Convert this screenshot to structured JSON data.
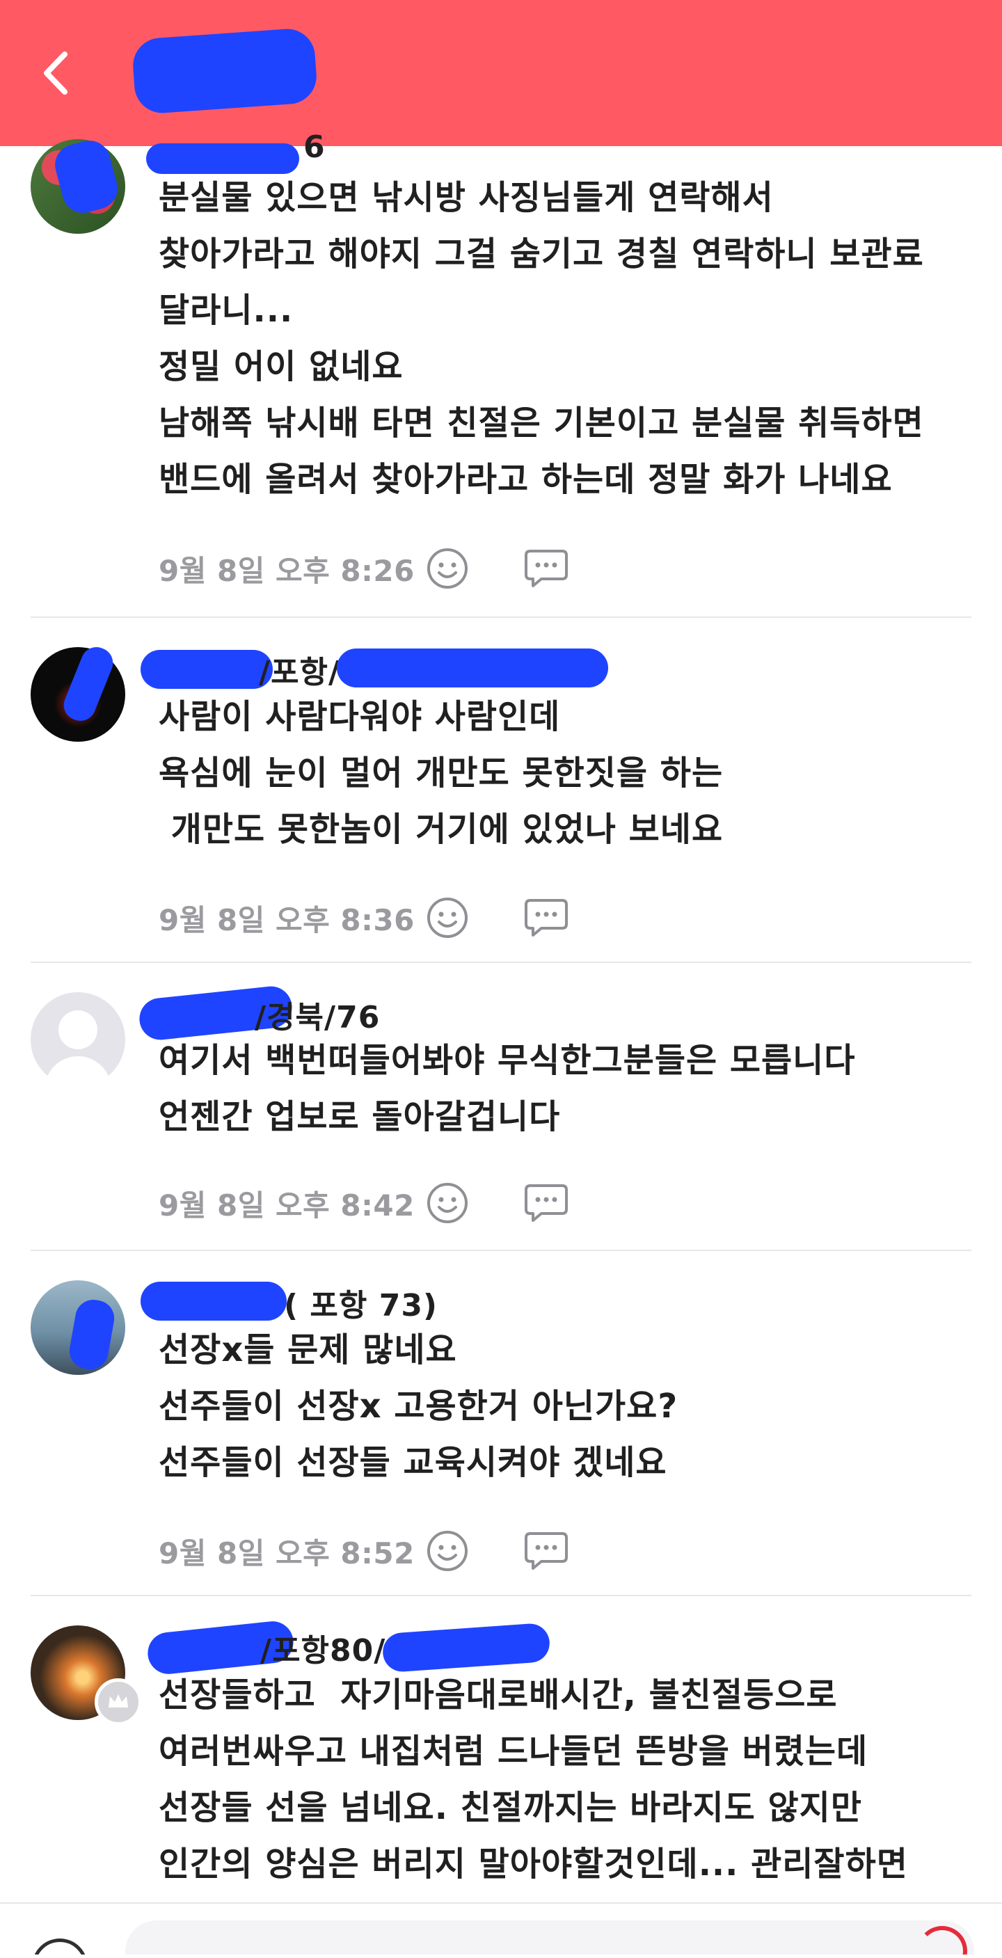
{
  "theme": {
    "accent": "#ff5a64",
    "redaction": "#1f44ff"
  },
  "header": {
    "back_icon": "chevron-left-icon",
    "title": ""
  },
  "comments": [
    {
      "author": "6",
      "avatar": "photo",
      "lines": [
        "분실물 있으면 낚시방 사징님들게 연락해서",
        "찾아가라고 해야지 그걸 숨기고 경칠 연락하니 보관료",
        "달라니...",
        "정밀 어이 없네요",
        "남해쪽 낚시배 타면 친절은 기본이고 분실물 취득하면",
        "밴드에 올려서 찾아가라고 하는데 정말 화가 나네요"
      ],
      "time": "9월 8일 오후 8:26"
    },
    {
      "author": "/포항/",
      "avatar": "photo",
      "lines": [
        "사람이 사람다워야 사람인데",
        "욕심에 눈이 멀어 개만도 못한짓을 하는",
        " 개만도 못한놈이 거기에 있었나 보네요"
      ],
      "time": "9월 8일 오후 8:36"
    },
    {
      "author": "/경북/76",
      "avatar": "default",
      "lines": [
        "여기서 백번떠들어봐야 무식한그분들은 모릅니다",
        "언젠간 업보로 돌아갈겁니다"
      ],
      "time": "9월 8일 오후 8:42"
    },
    {
      "author": "( 포항 73)",
      "avatar": "photo",
      "lines": [
        "선장x들 문제 많네요",
        "선주들이 선장x 고용한거 아닌가요?",
        "선주들이 선장들 교육시켜야 겠네요"
      ],
      "time": "9월 8일 오후 8:52"
    },
    {
      "author": "/포항80/",
      "avatar": "photo",
      "badge_icon": "crown-icon",
      "lines": [
        "선장들하고  자기마음대로배시간, 불친절등으로",
        "여러번싸우고 내집처럼 드나들던 뜬방을 버렸는데",
        "선장들 선을 넘네요. 친절까지는 바라지도 않지만",
        "인간의 양심은 버리지 말아야할것인데... 관리잘하면"
      ],
      "time": ""
    }
  ],
  "icons": {
    "reaction": "smiley-icon",
    "reply": "speech-bubble-icon"
  }
}
